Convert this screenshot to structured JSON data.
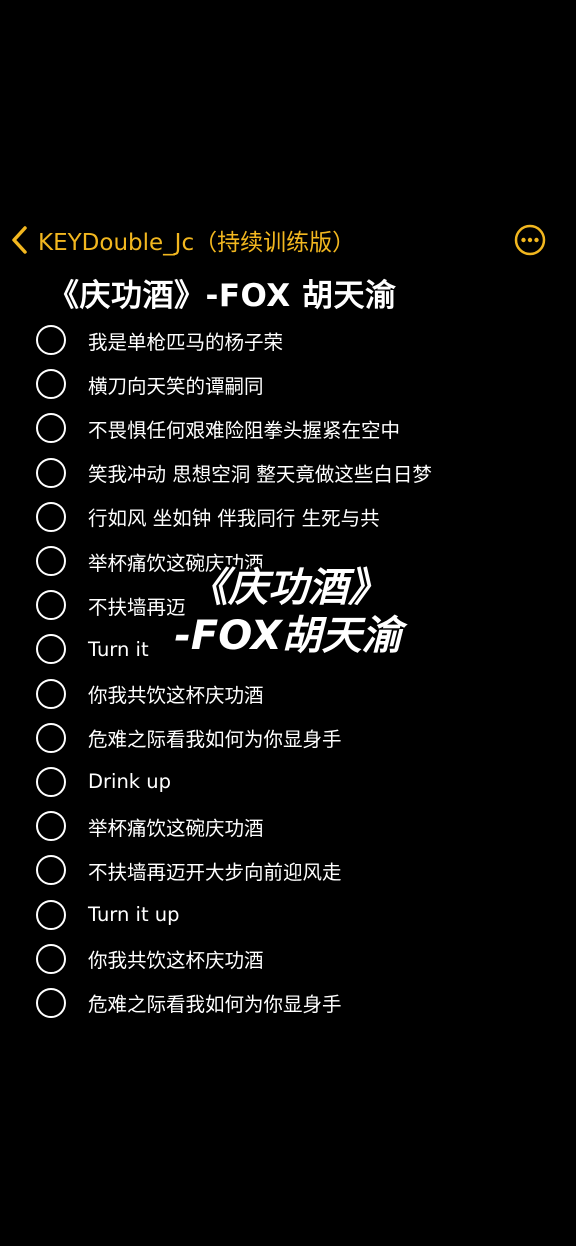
{
  "nav": {
    "back_label": "KEYDouble_Jc（持续训练版）",
    "back_icon": "chevron-left-icon",
    "more_icon": "ellipsis-circle-icon"
  },
  "title": "《庆功酒》-FOX 胡天渝",
  "items": [
    "我是单枪匹马的杨子荣",
    "横刀向天笑的谭嗣同",
    "不畏惧任何艰难险阻拳头握紧在空中",
    "笑我冲动 思想空洞 整天竟做这些白日梦",
    "行如风 坐如钟 伴我同行 生死与共",
    "举杯痛饮这碗庆功酒",
    "不扶墙再迈",
    "Turn it",
    "你我共饮这杯庆功酒",
    "危难之际看我如何为你显身手",
    "Drink up",
    "举杯痛饮这碗庆功酒",
    "不扶墙再迈开大步向前迎风走",
    "Turn it up",
    "你我共饮这杯庆功酒",
    "危难之际看我如何为你显身手"
  ],
  "overlay": {
    "line1": "《庆功酒》",
    "line2": "-FOX胡天渝"
  },
  "colors": {
    "background": "#000000",
    "accent": "#f2b71f",
    "text": "#ffffff"
  }
}
